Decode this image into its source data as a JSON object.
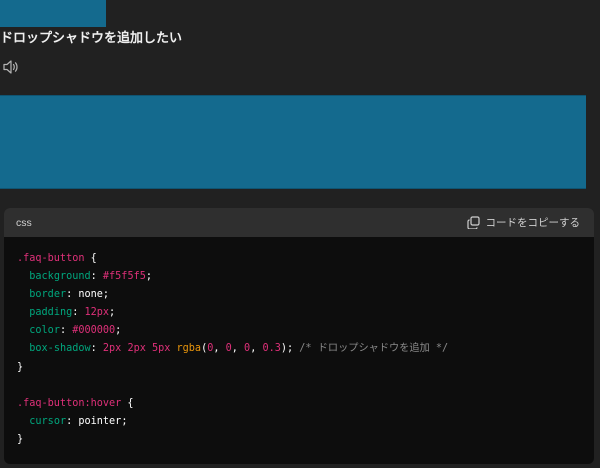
{
  "message": {
    "heading": "ドロップシャドウを追加したい"
  },
  "code_block": {
    "language": "css",
    "copy_label": "コードをコピーする",
    "rule1": {
      "selector": ".faq-button",
      "open": " {",
      "close": "}",
      "decls": [
        {
          "prop": "background",
          "value": "#f5f5f5"
        },
        {
          "prop": "border",
          "value": "none"
        },
        {
          "prop": "padding",
          "value": "12px"
        },
        {
          "prop": "color",
          "value": "#000000"
        }
      ],
      "shadow": {
        "prop": "box-shadow",
        "value_pre": "2px 2px 5px ",
        "fn": "rgba",
        "args_open": "(",
        "n1": "0",
        "n2": "0",
        "n3": "0",
        "n4": "0.3",
        "args_close": ")",
        "comment": "/* ドロップシャドウを追加 */"
      }
    },
    "rule2": {
      "selector": ".faq-button:hover",
      "open": " {",
      "close": "}",
      "decls": [
        {
          "prop": "cursor",
          "value": "pointer"
        }
      ]
    }
  },
  "colors": {
    "page_bg": "#212121",
    "accent_blue": "#146a8e",
    "code_bg": "#0d0d0d",
    "code_header_bg": "#2f2f2f",
    "selector": "#df3079",
    "property": "#00a67d",
    "function": "#e9950c",
    "comment": "#8a8a8a"
  },
  "icons": [
    "speaker-icon",
    "copy-icon"
  ]
}
